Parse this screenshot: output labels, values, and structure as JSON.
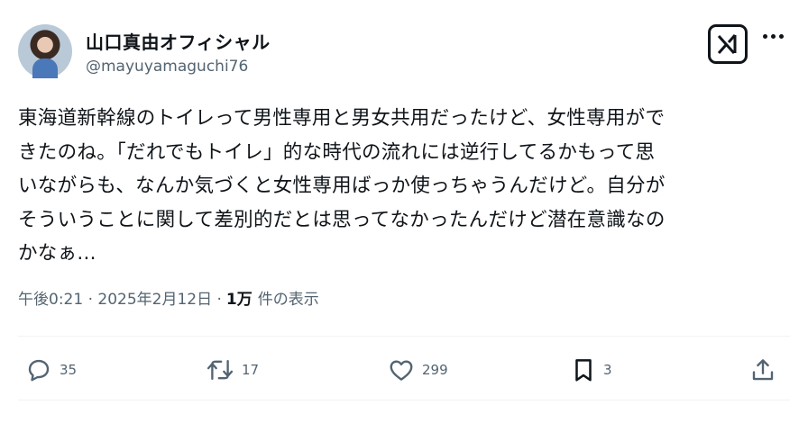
{
  "author": {
    "name": "山口真由オフィシャル",
    "handle": "@mayuyamaguchi76"
  },
  "tweet": {
    "lines": [
      "東海道新幹線のトイレって男性専用と男女共用だったけど、女性専用がで",
      "きたのね。「だれでもトイレ」的な時代の流れには逆行してるかもって思",
      "いながらも、なんか気づくと女性専用ばっか使っちゃうんだけど。自分が",
      "そういうことに関して差別的だとは思ってなかったんだけど潜在意識なの",
      "かなぁ..."
    ]
  },
  "meta": {
    "timestamp": "午後0:21 · 2025年2月12日 · ",
    "views_count": "1万",
    "views_label": "件の表示"
  },
  "actions": {
    "replies": "35",
    "reposts": "17",
    "likes": "299",
    "bookmarks": "3"
  },
  "icons": {
    "reply": "reply-icon",
    "repost": "repost-icon",
    "like": "heart-icon",
    "bookmark": "bookmark-icon",
    "share": "share-icon",
    "grok": "grok-icon",
    "more": "more-icon"
  },
  "colors": {
    "text": "#0f1419",
    "secondary": "#536471",
    "divider": "#eff3f4"
  }
}
